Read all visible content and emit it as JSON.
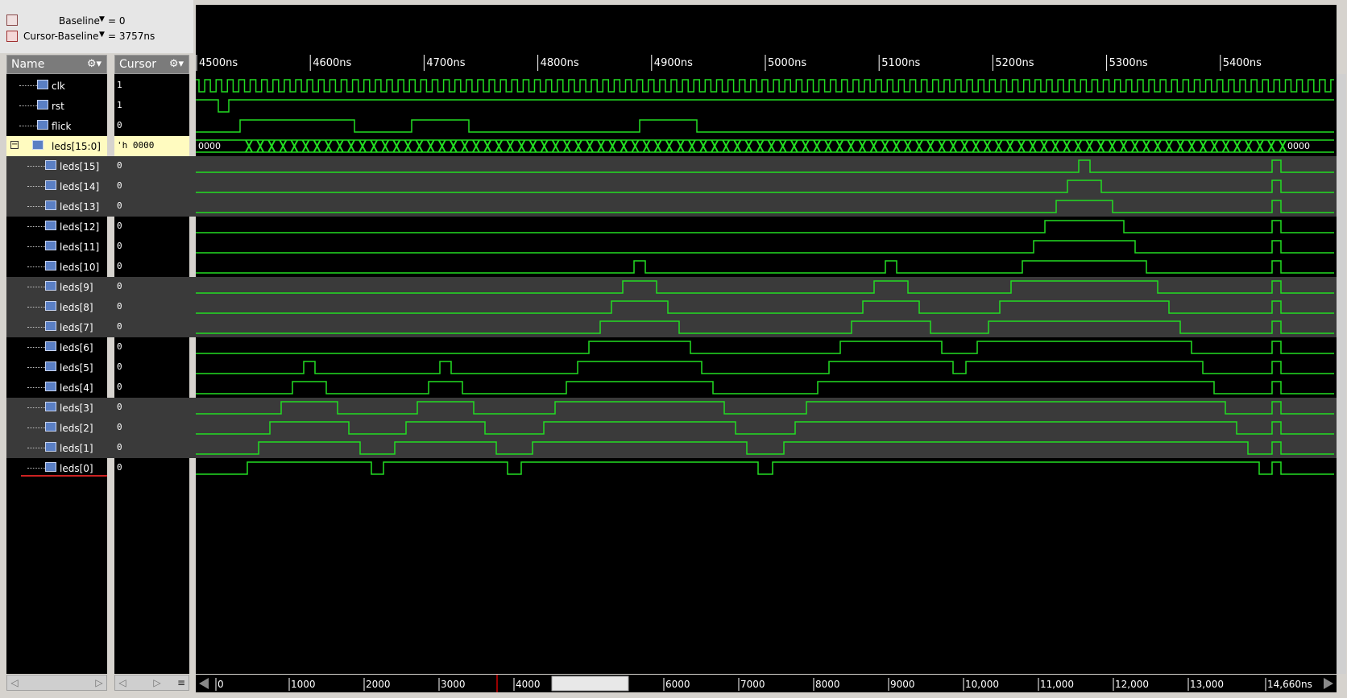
{
  "top": {
    "baseline_label": "Baseline",
    "baseline_value": "= 0",
    "cursor_baseline_label": "Cursor-Baseline",
    "cursor_baseline_value": "= 3757ns"
  },
  "headers": {
    "name": "Name",
    "cursor": "Cursor"
  },
  "timeline": {
    "ticks": [
      "4500ns",
      "4600ns",
      "4700ns",
      "4800ns",
      "4900ns",
      "5000ns",
      "5100ns",
      "5200ns",
      "5300ns",
      "5400ns"
    ]
  },
  "signals": [
    {
      "name": "clk",
      "value": "1"
    },
    {
      "name": "rst",
      "value": "1"
    },
    {
      "name": "flick",
      "value": "0"
    },
    {
      "name": "leds[15:0]",
      "value": "'h 0000",
      "bus_left": "0000",
      "bus_right": "0000"
    },
    {
      "name": "leds[15]",
      "value": "0"
    },
    {
      "name": "leds[14]",
      "value": "0"
    },
    {
      "name": "leds[13]",
      "value": "0"
    },
    {
      "name": "leds[12]",
      "value": "0"
    },
    {
      "name": "leds[11]",
      "value": "0"
    },
    {
      "name": "leds[10]",
      "value": "0"
    },
    {
      "name": "leds[9]",
      "value": "0"
    },
    {
      "name": "leds[8]",
      "value": "0"
    },
    {
      "name": "leds[7]",
      "value": "0"
    },
    {
      "name": "leds[6]",
      "value": "0"
    },
    {
      "name": "leds[5]",
      "value": "0"
    },
    {
      "name": "leds[4]",
      "value": "0"
    },
    {
      "name": "leds[3]",
      "value": "0"
    },
    {
      "name": "leds[2]",
      "value": "0"
    },
    {
      "name": "leds[1]",
      "value": "0"
    },
    {
      "name": "leds[0]",
      "value": "0"
    }
  ],
  "overview": {
    "ticks": [
      "0",
      "1000",
      "2000",
      "3000",
      "4000",
      "6000",
      "7000",
      "8000",
      "9000",
      "10,000",
      "11,000",
      "12,000",
      "13,000",
      "14,660ns"
    ]
  },
  "colors": {
    "wave": "#22dd22",
    "background": "#000000",
    "bus_highlight": "#fffbc0",
    "row_band": "#3a3a3a",
    "cursor": "#cc0000"
  }
}
